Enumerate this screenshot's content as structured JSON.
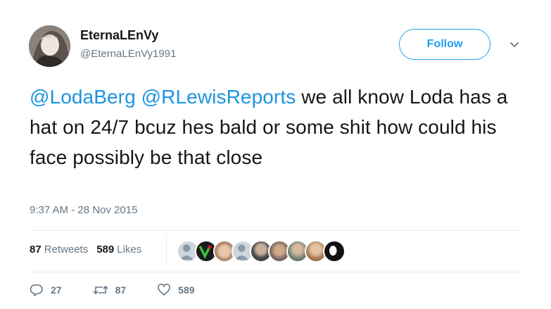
{
  "user": {
    "display_name": "EternaLEnVy",
    "handle": "@EternaLEnVy1991"
  },
  "follow_button": {
    "label": "Follow"
  },
  "tweet": {
    "mention1": "@LodaBerg",
    "mention2": "@RLewisReports",
    "body": " we all know Loda has a hat on 24/7 bcuz hes bald or some shit how could his face possibly be that close",
    "timestamp": "9:37 AM - 28 Nov 2015"
  },
  "stats": {
    "retweets_count": "87",
    "retweets_label": "Retweets",
    "likes_count": "589",
    "likes_label": "Likes"
  },
  "actions": {
    "reply_count": "27",
    "retweet_count": "87",
    "like_count": "589"
  },
  "colors": {
    "accent": "#1da1f2",
    "mention": "#1b95e0",
    "secondary_text": "#657786"
  },
  "icons": [
    "reply-icon",
    "retweet-icon",
    "like-icon",
    "chevron-down-icon"
  ]
}
